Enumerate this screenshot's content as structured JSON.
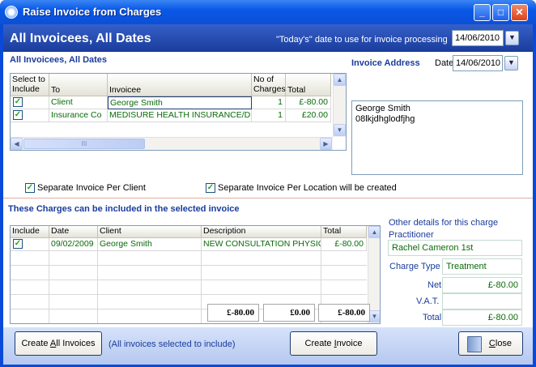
{
  "window": {
    "title": "Raise Invoice from Charges"
  },
  "header": {
    "title": "All Invoicees, All Dates",
    "date_label": "\"Today's\" date to use for invoice processing",
    "date_value": "14/06/2010"
  },
  "invoicees": {
    "section_title": "All Invoicees, All Dates",
    "columns": [
      "Select to Include",
      "To",
      "Invoicee",
      "No of Charges",
      "Total"
    ],
    "rows": [
      {
        "checked": true,
        "to": "Client",
        "invoicee": "George Smith",
        "charges": "1",
        "total": "£-80.00"
      },
      {
        "checked": true,
        "to": "Insurance Co",
        "invoicee": "MEDISURE HEALTH INSURANCE/Dr J",
        "charges": "1",
        "total": "£20.00"
      }
    ],
    "hscroll_label": "III"
  },
  "invoice_address": {
    "title": "Invoice Address",
    "date_label": "Date",
    "date_value": "14/06/2010",
    "lines": [
      "George Smith",
      "08lkjdhglodfjhg"
    ]
  },
  "options": {
    "separate_client": "Separate Invoice Per Client",
    "separate_location": "Separate Invoice Per Location will be created"
  },
  "charges": {
    "section_title": "These Charges can be included in the selected invoice",
    "columns": [
      "Include",
      "Date",
      "Client",
      "Description",
      "Total"
    ],
    "rows": [
      {
        "checked": true,
        "date": "09/02/2009",
        "client": "George Smith",
        "description": "NEW CONSULTATION PHYSIO",
        "total": "£-80.00"
      }
    ],
    "totals": [
      "£-80.00",
      "£0.00",
      "£-80.00"
    ]
  },
  "other_details": {
    "title": "Other details for this charge",
    "practitioner_label": "Practitioner",
    "practitioner": "Rachel Cameron 1st",
    "charge_type_label": "Charge Type",
    "charge_type": "Treatment",
    "net_label": "Net",
    "net": "£-80.00",
    "vat_label": "V.A.T.",
    "vat": "",
    "total_label": "Total",
    "total": "£-80.00"
  },
  "footer": {
    "create_all_pre": "Create ",
    "create_all_u": "A",
    "create_all_post": "ll Invoices",
    "note": "(All invoices selected to include)",
    "create_pre": "Create ",
    "create_u": "I",
    "create_post": "nvoice",
    "close_u": "C",
    "close_post": "lose"
  }
}
